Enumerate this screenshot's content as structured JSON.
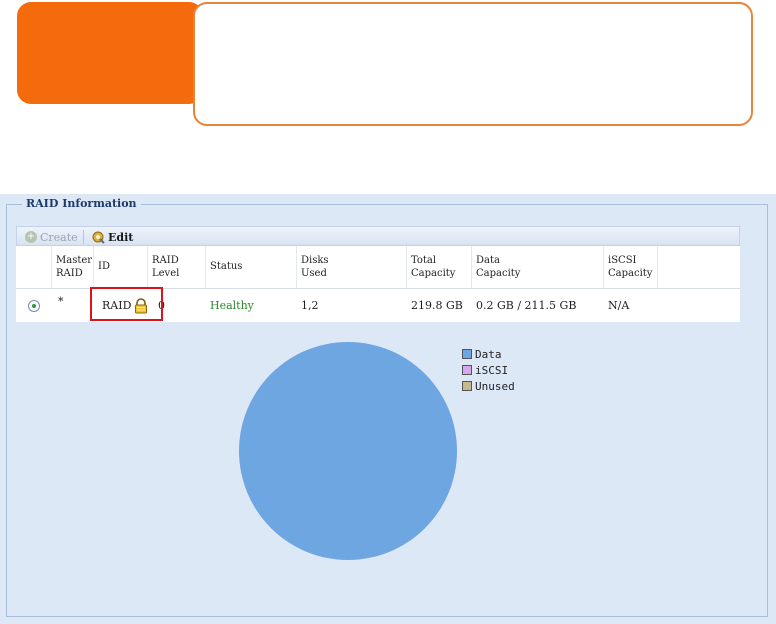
{
  "panel": {
    "legend": "RAID Information"
  },
  "toolbar": {
    "create_label": "Create",
    "edit_label": "Edit"
  },
  "table": {
    "headers": {
      "master": [
        "Master",
        "RAID"
      ],
      "id": "ID",
      "level": [
        "RAID",
        "Level"
      ],
      "status": "Status",
      "disks": [
        "Disks",
        "Used"
      ],
      "total": [
        "Total",
        "Capacity"
      ],
      "data": [
        "Data",
        "Capacity"
      ],
      "iscsi": [
        "iSCSI",
        "Capacity"
      ]
    },
    "rows": [
      {
        "master": "*",
        "id": "RAID",
        "level": "0",
        "status": "Healthy",
        "disks": "1,2",
        "total": "219.8 GB",
        "data": "0.2 GB / 211.5 GB",
        "iscsi": "N/A"
      }
    ]
  },
  "chart_data": {
    "type": "pie",
    "categories": [
      "Data",
      "iSCSI",
      "Unused"
    ],
    "values": [
      211.5,
      0,
      0
    ],
    "colors": [
      "#6ea6e2",
      "#d8a8ec",
      "#c5b88d"
    ],
    "legend_position": "top-right"
  }
}
